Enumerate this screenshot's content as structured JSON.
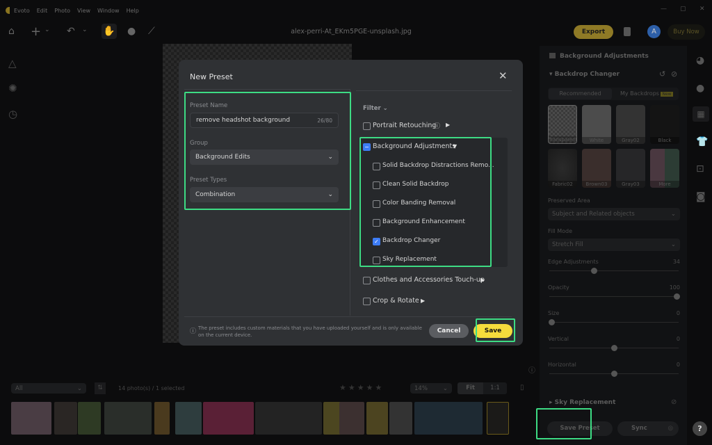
{
  "titlebar": {
    "app": "Evoto",
    "menus": [
      "Edit",
      "Photo",
      "View",
      "Window",
      "Help"
    ],
    "window_controls": [
      "minimize-icon",
      "maximize-icon",
      "close-icon"
    ]
  },
  "toolbar": {
    "filename": "alex-perri-At_EKm5PGE-unsplash.jpg",
    "export": "Export",
    "avatar": "A",
    "buy_now": "Buy Now"
  },
  "right_panel": {
    "section": "Background Adjustments",
    "subsection": "Backdrop Changer",
    "tabs": [
      "Recommended",
      "My Backdrops"
    ],
    "new_badge": "New",
    "swatches": [
      "Transparent",
      "White",
      "Gray02",
      "Black",
      "Fabric02",
      "Brown03",
      "Gray03",
      "More"
    ],
    "preserved_area": {
      "label": "Preserved Area",
      "value": "Subject and Related objects"
    },
    "fill_mode": {
      "label": "Fill Mode",
      "value": "Stretch Fill"
    },
    "sliders": [
      {
        "label": "Edge Adjustments",
        "value": "34",
        "fraction": 0.34
      },
      {
        "label": "Opacity",
        "value": "100",
        "fraction": 1.0
      },
      {
        "label": "Size",
        "value": "0",
        "fraction": 0.0
      },
      {
        "label": "Vertical",
        "value": "0",
        "fraction": 0.5
      },
      {
        "label": "Horizontal",
        "value": "0",
        "fraction": 0.5
      }
    ],
    "sky": "Sky Replacement",
    "save_preset": "Save Preset",
    "sync": "Sync",
    "help": "?"
  },
  "filmstrip": {
    "filter": "All",
    "count": "14 photo(s) / 1 selected",
    "zoom": "14%",
    "fit": "Fit",
    "one_to_one": "1:1",
    "rating": 0
  },
  "modal": {
    "title": "New Preset",
    "preset_name_label": "Preset Name",
    "preset_name": "remove headshot background",
    "char_count": "26/80",
    "group_label": "Group",
    "group": "Background Edits",
    "types_label": "Preset Types",
    "types": "Combination",
    "filter": "Filter",
    "categories": [
      {
        "label": "Portrait Retouching",
        "checked": false
      },
      {
        "label": "Background Adjustments",
        "checked": "partial"
      },
      {
        "label": "Clothes and Accessories Touch-up",
        "checked": false
      },
      {
        "label": "Crop & Rotate",
        "checked": false
      }
    ],
    "sub_items": [
      {
        "label": "Solid Backdrop Distractions Remo...",
        "checked": false
      },
      {
        "label": "Clean Solid Backdrop",
        "checked": false
      },
      {
        "label": "Color Banding Removal",
        "checked": false
      },
      {
        "label": "Background Enhancement",
        "checked": false
      },
      {
        "label": "Backdrop Changer",
        "checked": true
      },
      {
        "label": "Sky Replacement",
        "checked": false
      }
    ],
    "note": "The preset includes custom materials that you have uploaded yourself and is only available on the current device.",
    "cancel": "Cancel",
    "save": "Save"
  },
  "colors": {
    "accent_yellow": "#f5dc3c",
    "highlight_green": "#3ddc84",
    "checkbox_blue": "#3d7cf5"
  }
}
